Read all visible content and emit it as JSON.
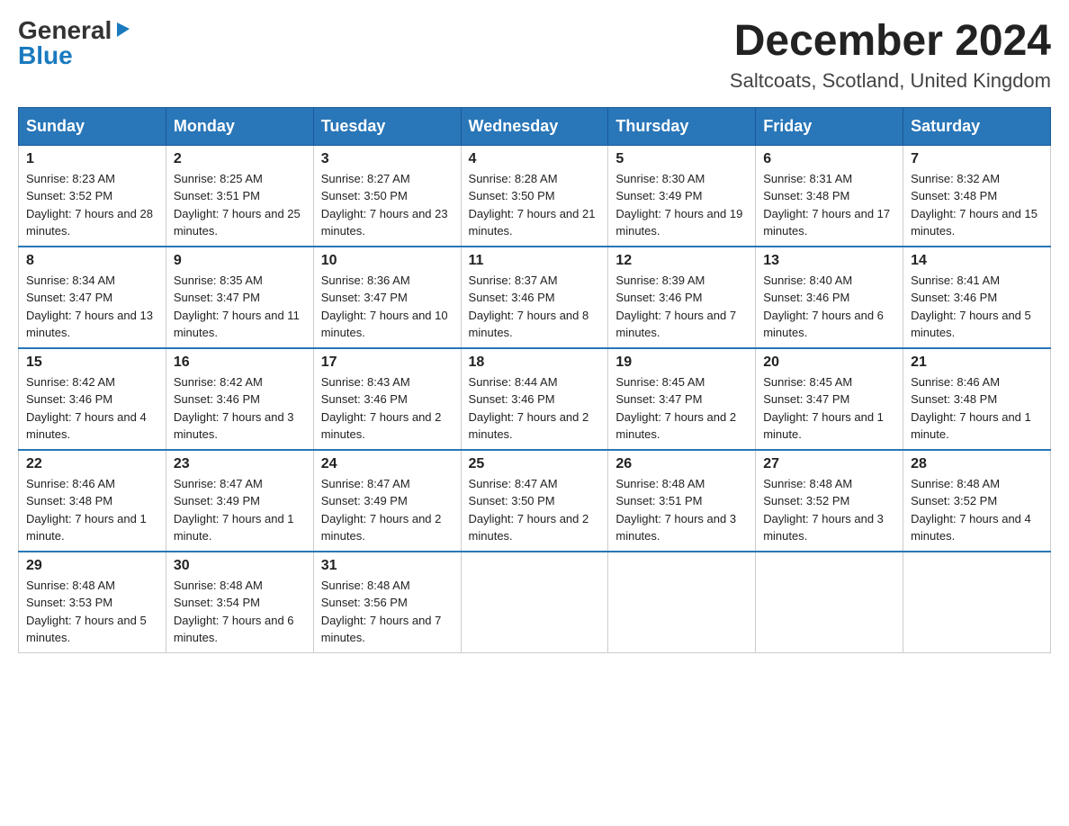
{
  "header": {
    "logo_general": "General",
    "logo_blue": "Blue",
    "month_title": "December 2024",
    "location": "Saltcoats, Scotland, United Kingdom"
  },
  "days_of_week": [
    "Sunday",
    "Monday",
    "Tuesday",
    "Wednesday",
    "Thursday",
    "Friday",
    "Saturday"
  ],
  "weeks": [
    [
      {
        "day": "1",
        "sunrise": "8:23 AM",
        "sunset": "3:52 PM",
        "daylight": "7 hours and 28 minutes."
      },
      {
        "day": "2",
        "sunrise": "8:25 AM",
        "sunset": "3:51 PM",
        "daylight": "7 hours and 25 minutes."
      },
      {
        "day": "3",
        "sunrise": "8:27 AM",
        "sunset": "3:50 PM",
        "daylight": "7 hours and 23 minutes."
      },
      {
        "day": "4",
        "sunrise": "8:28 AM",
        "sunset": "3:50 PM",
        "daylight": "7 hours and 21 minutes."
      },
      {
        "day": "5",
        "sunrise": "8:30 AM",
        "sunset": "3:49 PM",
        "daylight": "7 hours and 19 minutes."
      },
      {
        "day": "6",
        "sunrise": "8:31 AM",
        "sunset": "3:48 PM",
        "daylight": "7 hours and 17 minutes."
      },
      {
        "day": "7",
        "sunrise": "8:32 AM",
        "sunset": "3:48 PM",
        "daylight": "7 hours and 15 minutes."
      }
    ],
    [
      {
        "day": "8",
        "sunrise": "8:34 AM",
        "sunset": "3:47 PM",
        "daylight": "7 hours and 13 minutes."
      },
      {
        "day": "9",
        "sunrise": "8:35 AM",
        "sunset": "3:47 PM",
        "daylight": "7 hours and 11 minutes."
      },
      {
        "day": "10",
        "sunrise": "8:36 AM",
        "sunset": "3:47 PM",
        "daylight": "7 hours and 10 minutes."
      },
      {
        "day": "11",
        "sunrise": "8:37 AM",
        "sunset": "3:46 PM",
        "daylight": "7 hours and 8 minutes."
      },
      {
        "day": "12",
        "sunrise": "8:39 AM",
        "sunset": "3:46 PM",
        "daylight": "7 hours and 7 minutes."
      },
      {
        "day": "13",
        "sunrise": "8:40 AM",
        "sunset": "3:46 PM",
        "daylight": "7 hours and 6 minutes."
      },
      {
        "day": "14",
        "sunrise": "8:41 AM",
        "sunset": "3:46 PM",
        "daylight": "7 hours and 5 minutes."
      }
    ],
    [
      {
        "day": "15",
        "sunrise": "8:42 AM",
        "sunset": "3:46 PM",
        "daylight": "7 hours and 4 minutes."
      },
      {
        "day": "16",
        "sunrise": "8:42 AM",
        "sunset": "3:46 PM",
        "daylight": "7 hours and 3 minutes."
      },
      {
        "day": "17",
        "sunrise": "8:43 AM",
        "sunset": "3:46 PM",
        "daylight": "7 hours and 2 minutes."
      },
      {
        "day": "18",
        "sunrise": "8:44 AM",
        "sunset": "3:46 PM",
        "daylight": "7 hours and 2 minutes."
      },
      {
        "day": "19",
        "sunrise": "8:45 AM",
        "sunset": "3:47 PM",
        "daylight": "7 hours and 2 minutes."
      },
      {
        "day": "20",
        "sunrise": "8:45 AM",
        "sunset": "3:47 PM",
        "daylight": "7 hours and 1 minute."
      },
      {
        "day": "21",
        "sunrise": "8:46 AM",
        "sunset": "3:48 PM",
        "daylight": "7 hours and 1 minute."
      }
    ],
    [
      {
        "day": "22",
        "sunrise": "8:46 AM",
        "sunset": "3:48 PM",
        "daylight": "7 hours and 1 minute."
      },
      {
        "day": "23",
        "sunrise": "8:47 AM",
        "sunset": "3:49 PM",
        "daylight": "7 hours and 1 minute."
      },
      {
        "day": "24",
        "sunrise": "8:47 AM",
        "sunset": "3:49 PM",
        "daylight": "7 hours and 2 minutes."
      },
      {
        "day": "25",
        "sunrise": "8:47 AM",
        "sunset": "3:50 PM",
        "daylight": "7 hours and 2 minutes."
      },
      {
        "day": "26",
        "sunrise": "8:48 AM",
        "sunset": "3:51 PM",
        "daylight": "7 hours and 3 minutes."
      },
      {
        "day": "27",
        "sunrise": "8:48 AM",
        "sunset": "3:52 PM",
        "daylight": "7 hours and 3 minutes."
      },
      {
        "day": "28",
        "sunrise": "8:48 AM",
        "sunset": "3:52 PM",
        "daylight": "7 hours and 4 minutes."
      }
    ],
    [
      {
        "day": "29",
        "sunrise": "8:48 AM",
        "sunset": "3:53 PM",
        "daylight": "7 hours and 5 minutes."
      },
      {
        "day": "30",
        "sunrise": "8:48 AM",
        "sunset": "3:54 PM",
        "daylight": "7 hours and 6 minutes."
      },
      {
        "day": "31",
        "sunrise": "8:48 AM",
        "sunset": "3:56 PM",
        "daylight": "7 hours and 7 minutes."
      },
      null,
      null,
      null,
      null
    ]
  ]
}
